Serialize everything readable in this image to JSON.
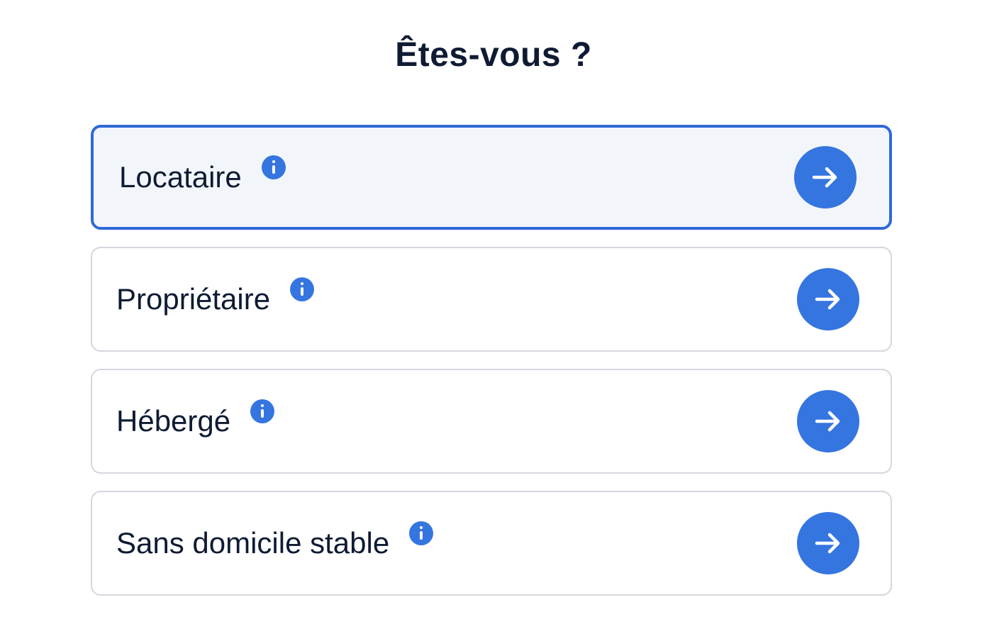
{
  "page": {
    "title": "Êtes-vous ?"
  },
  "options": [
    {
      "label": "Locataire",
      "selected": true,
      "info_icon": "info-icon",
      "action_icon": "arrow-right-icon"
    },
    {
      "label": "Propriétaire",
      "selected": false,
      "info_icon": "info-icon",
      "action_icon": "arrow-right-icon"
    },
    {
      "label": "Hébergé",
      "selected": false,
      "info_icon": "info-icon",
      "action_icon": "arrow-right-icon"
    },
    {
      "label": "Sans domicile stable",
      "selected": false,
      "info_icon": "info-icon",
      "action_icon": "arrow-right-icon"
    }
  ],
  "colors": {
    "accent": "#3575e0",
    "selected_border": "#3069d8",
    "selected_background": "#f2f6fb",
    "border": "#d4d7de",
    "text": "#0f1b33"
  }
}
